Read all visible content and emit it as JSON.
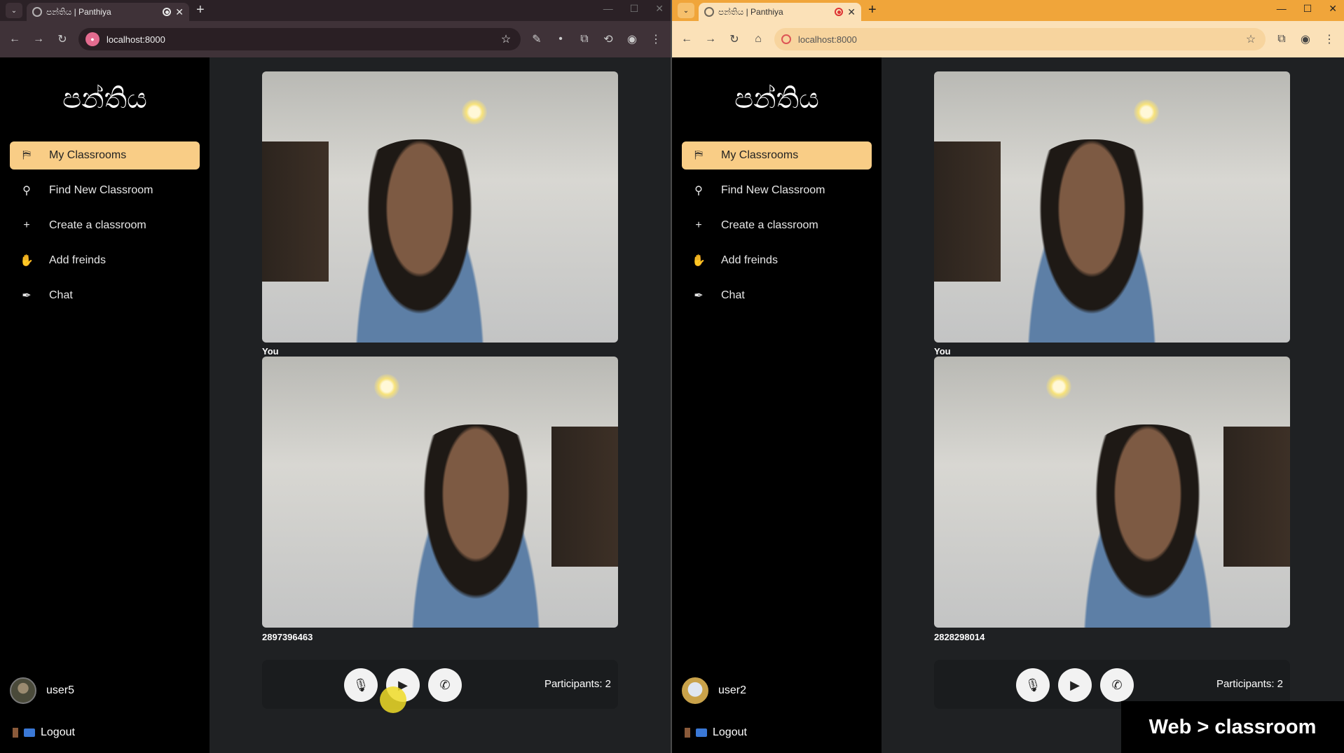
{
  "windows": [
    {
      "tab_title": "පන්තිය | Panthiya",
      "url": "localhost:8000",
      "logo": "පන්තිය",
      "nav": [
        {
          "label": "My Classrooms",
          "icon": "classroom-icon"
        },
        {
          "label": "Find New Classroom",
          "icon": "search-icon"
        },
        {
          "label": "Create a classroom",
          "icon": "plus-icon"
        },
        {
          "label": "Add freinds",
          "icon": "handshake-icon"
        },
        {
          "label": "Chat",
          "icon": "feather-icon"
        }
      ],
      "username": "user5",
      "logout": "Logout",
      "video_self_label": "You",
      "video_peer_label": "2897396463",
      "participants": "Participants: 2"
    },
    {
      "tab_title": "පන්තිය | Panthiya",
      "url": "localhost:8000",
      "logo": "පන්තිය",
      "nav": [
        {
          "label": "My Classrooms",
          "icon": "classroom-icon"
        },
        {
          "label": "Find New Classroom",
          "icon": "search-icon"
        },
        {
          "label": "Create a classroom",
          "icon": "plus-icon"
        },
        {
          "label": "Add freinds",
          "icon": "handshake-icon"
        },
        {
          "label": "Chat",
          "icon": "feather-icon"
        }
      ],
      "username": "user2",
      "logout": "Logout",
      "video_self_label": "You",
      "video_peer_label": "2828298014",
      "participants": "Participants: 2"
    }
  ],
  "caption": "Web > classroom",
  "colors": {
    "accent": "#f9cd86",
    "sidebar": "#000000",
    "main_bg": "#1f2123",
    "right_chrome": "#f0a53a"
  }
}
